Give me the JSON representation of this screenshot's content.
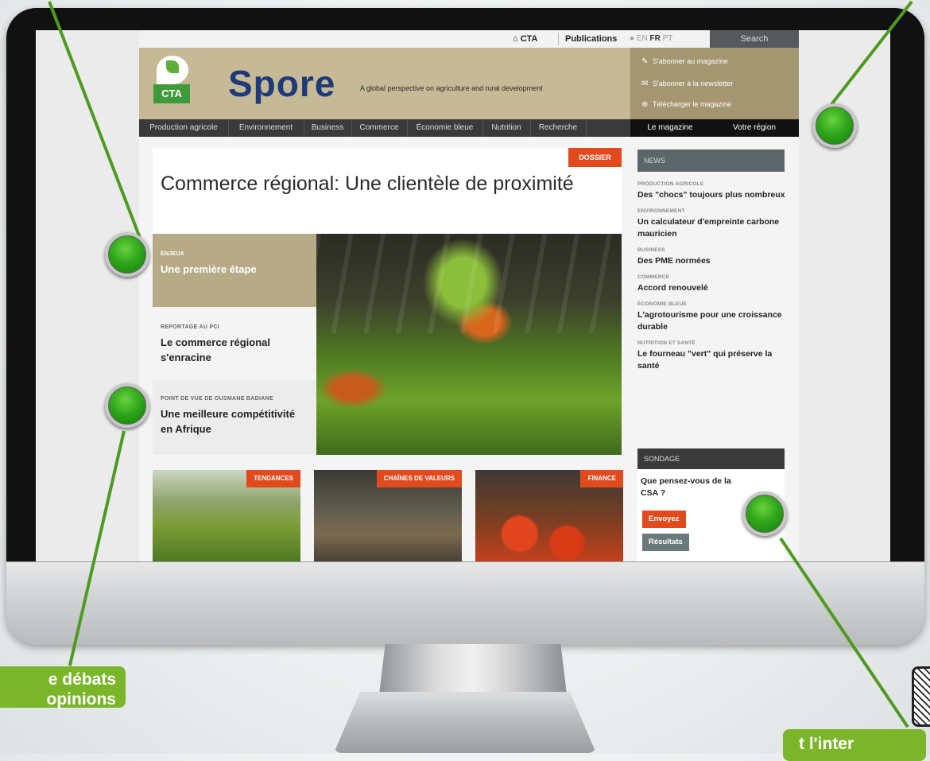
{
  "topbar": {
    "home_label": "CTA",
    "publications_label": "Publications",
    "lang_en": "EN",
    "lang_fr": "FR",
    "lang_pt": "PT",
    "search_placeholder": "Search"
  },
  "header": {
    "logo_text": "CTA",
    "brand": "Spore",
    "tagline": "A global perspective on agriculture and rural development",
    "promo": [
      {
        "label": "S'abonner au magazine",
        "icon": "pencil-icon"
      },
      {
        "label": "S'abonner à la newsletter",
        "icon": "mail-icon"
      },
      {
        "label": "Télécharger le magazine",
        "icon": "download-icon"
      }
    ]
  },
  "nav": {
    "items": [
      "Production agricole",
      "Environnement",
      "Business",
      "Commerce",
      "Économie bleue",
      "Nutrition",
      "Recherche"
    ],
    "magazine": "Le magazine",
    "region": "Votre région"
  },
  "feature": {
    "tag": "DOSSIER",
    "title": "Commerce régional: Une clientèle de proximité",
    "sidelist": [
      {
        "kicker": "ENJEUX",
        "title": "Une première étape"
      },
      {
        "kicker": "REPORTAGE AU PCI",
        "title": "Le commerce régional s'enracine"
      },
      {
        "kicker": "POINT DE VUE DE OUSMANE BADIANE",
        "title": "Une meilleure compétitivité en Afrique"
      }
    ]
  },
  "cards": [
    {
      "tag": "TENDANCES"
    },
    {
      "tag": "CHAÎNES DE VALEURS"
    },
    {
      "tag": "FINANCE"
    }
  ],
  "news": {
    "header": "NEWS",
    "items": [
      {
        "category": "PRODUCTION AGRICOLE",
        "title": "Des \"chocs\" toujours plus nombreux"
      },
      {
        "category": "ENVIRONNEMENT",
        "title": "Un calculateur d'empreinte carbone mauricien"
      },
      {
        "category": "BUSINESS",
        "title": "Des PME normées"
      },
      {
        "category": "COMMERCE",
        "title": "Accord renouvelé"
      },
      {
        "category": "ÉCONOMIE BLEUE",
        "title": "L'agrotourisme pour une croissance durable"
      },
      {
        "category": "NUTRITION ET SANTÉ",
        "title": "Le fourneau \"vert\" qui préserve la santé"
      }
    ]
  },
  "poll": {
    "header": "SONDAGE",
    "question": "Que pensez-vous de la CSA ?",
    "send_label": "Envoyez",
    "results_label": "Résultats"
  },
  "callouts": {
    "left_label": "e débats opinions",
    "right_label": "t l'inter"
  },
  "colors": {
    "accent": "#e04a1c",
    "header_beige": "#c5b996",
    "brand_blue": "#1e3a78",
    "callout_green": "#7ab52a"
  }
}
